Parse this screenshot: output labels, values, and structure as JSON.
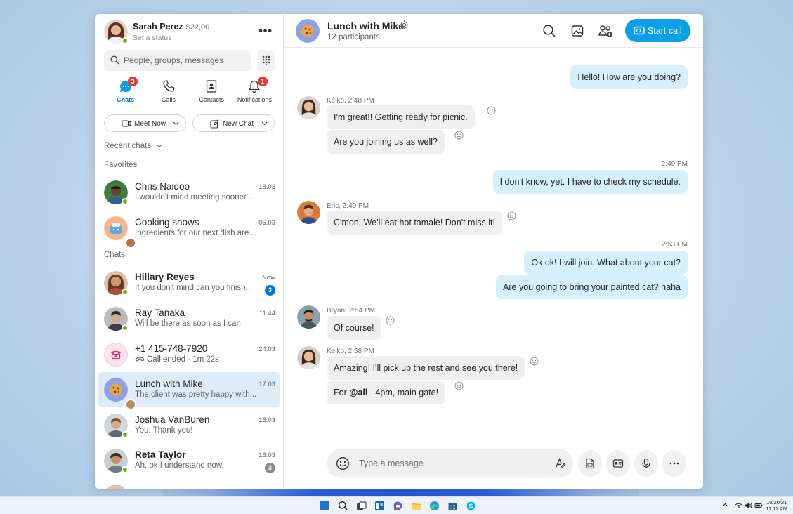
{
  "profile": {
    "name": "Sarah Perez",
    "credit": "$22,00",
    "status": "Set a status"
  },
  "search": {
    "placeholder": "People, groups, messages"
  },
  "nav": [
    {
      "label": "Chats",
      "badge": "3",
      "active": true
    },
    {
      "label": "Calls"
    },
    {
      "label": "Contacts"
    },
    {
      "label": "Notifications",
      "badge": "1"
    }
  ],
  "actions": {
    "meet_now": "Meet Now",
    "new_chat": "New Chat"
  },
  "sections": {
    "recent": "Recent chats",
    "favorites": "Favorites",
    "chats": "Chats"
  },
  "favorites": [
    {
      "name": "Chris Naidoo",
      "preview": "I wouldn't mind meeting sooner...",
      "time": "18.03"
    },
    {
      "name": "Cooking shows",
      "preview": "Ingredients for our next dish are...",
      "time": "05.03"
    }
  ],
  "chats": [
    {
      "name": "Hillary Reyes",
      "preview": "If you don't mind can you finish...",
      "time": "Now",
      "badge": "3"
    },
    {
      "name": "Ray Tanaka",
      "preview": "Will be there as soon as I can!",
      "time": "11:44"
    },
    {
      "name": "+1 415-748-7920",
      "preview": "Call ended - 1m 22s",
      "time": "24.03"
    },
    {
      "name": "Lunch with Mike",
      "preview": "The client was pretty happy with...",
      "time": "17.03"
    },
    {
      "name": "Joshua VanBuren",
      "preview": "You: Thank you!",
      "time": "16.03"
    },
    {
      "name": "Reta Taylor",
      "preview": "Ah, ok I understand now.",
      "time": "16.03",
      "badge": "3"
    }
  ],
  "conversation": {
    "title": "Lunch with Mike",
    "subtitle": "12 participants",
    "start_call": "Start call",
    "messages": [
      {
        "text": "Hello! How are you doing?"
      },
      {
        "sender": "Keiko, 2:48 PM",
        "text": "I'm great!! Getting ready for picnic."
      },
      {
        "text": "Are you joining us as well?"
      },
      {
        "time": "2:49 PM",
        "text": "I don't know, yet. I have to check my schedule."
      },
      {
        "sender": "Eric, 2:49 PM",
        "text": "C'mon! We'll eat hot tamale! Don't miss it!"
      },
      {
        "time": "2:53 PM",
        "text": "Ok ok! I will join. What about your cat?"
      },
      {
        "text": "Are you going to bring your painted cat? haha"
      },
      {
        "sender": "Bryan, 2:54 PM",
        "text": "Of course!"
      },
      {
        "sender": "Keiko, 2:58 PM",
        "text": "Amazing! I'll pick up the rest and see you there!"
      },
      {
        "text_prefix": "For ",
        "mention": "@all",
        "text_suffix": " - 4pm, main gate!"
      }
    ],
    "composer_placeholder": "Type a message"
  },
  "taskbar": {
    "date": "10/20/21",
    "time": "11:11 AM"
  },
  "colors": {
    "accent": "#0a9fe8",
    "presence": "#6bb700",
    "badge_red": "#e53935",
    "badge_blue": "#0078d4",
    "badge_gray": "#8a8a8a"
  }
}
